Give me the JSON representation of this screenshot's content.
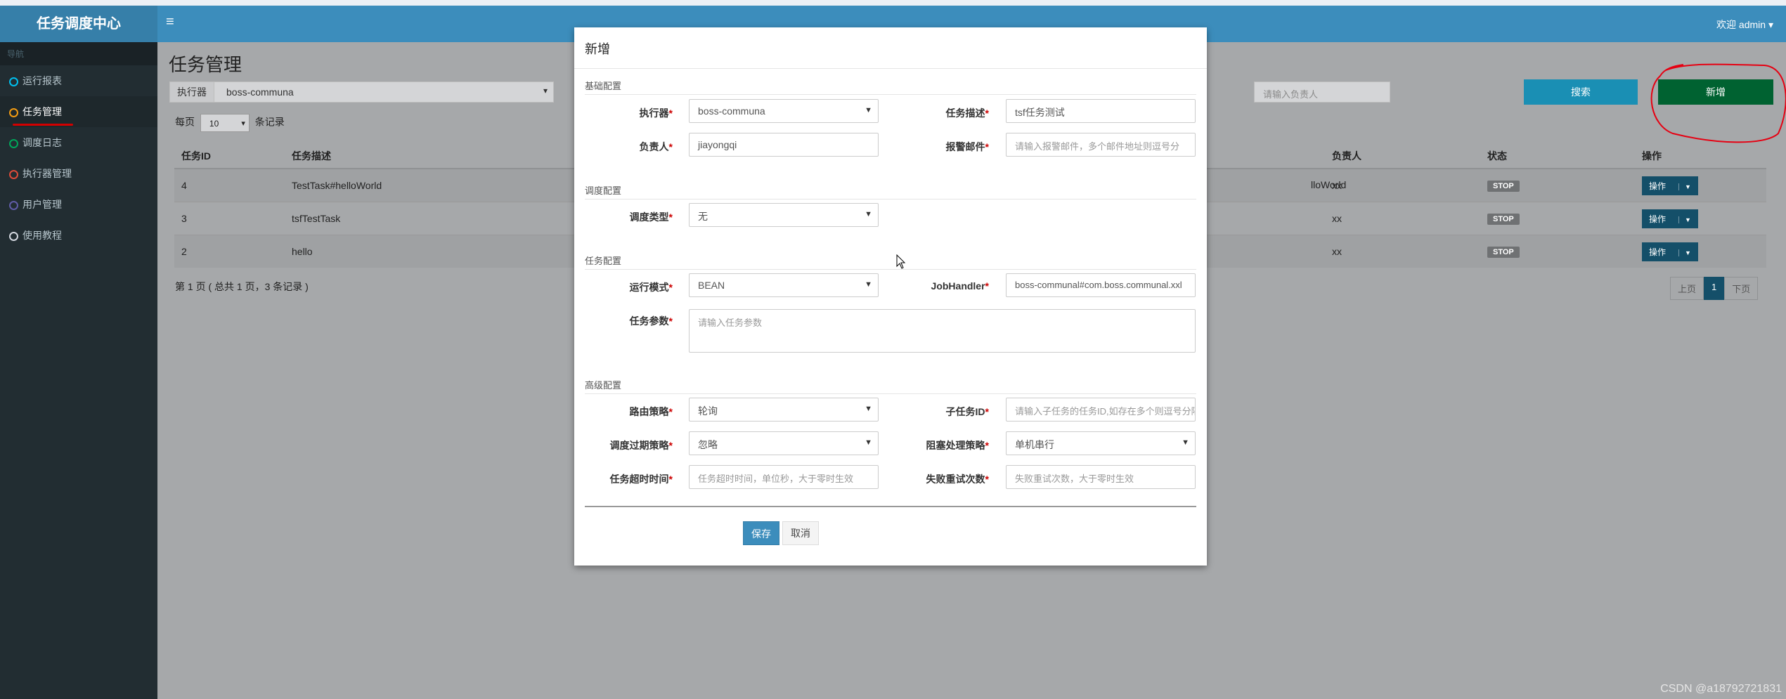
{
  "app": {
    "title": "任务调度中心",
    "user_greeting": "欢迎 admin"
  },
  "sidebar": {
    "header": "导航",
    "items": [
      {
        "label": "运行报表",
        "color": "#00c0ef"
      },
      {
        "label": "任务管理",
        "color": "#f39c12"
      },
      {
        "label": "调度日志",
        "color": "#00a65a"
      },
      {
        "label": "执行器管理",
        "color": "#dd4b39"
      },
      {
        "label": "用户管理",
        "color": "#605ca8"
      },
      {
        "label": "使用教程",
        "color": "#d2d6de"
      }
    ]
  },
  "page": {
    "title": "任务管理",
    "filter": {
      "executor_label": "执行器",
      "executor_value": "boss-communa",
      "person_placeholder": "请输入负责人",
      "search_label": "搜索",
      "add_label": "新增"
    },
    "per_page": {
      "prefix": "每页",
      "value": "10",
      "suffix": "条记录"
    },
    "table": {
      "headers": [
        "任务ID",
        "任务描述",
        "负责人",
        "状态",
        "操作"
      ],
      "rows": [
        {
          "id": "4",
          "desc": "TestTask#helloWorld",
          "handler_fragment": "lloWorld",
          "owner": "xx",
          "status": "STOP",
          "op": "操作"
        },
        {
          "id": "3",
          "desc": "tsfTestTask",
          "handler_fragment": "",
          "owner": "xx",
          "status": "STOP",
          "op": "操作"
        },
        {
          "id": "2",
          "desc": "hello",
          "handler_fragment": "",
          "owner": "xx",
          "status": "STOP",
          "op": "操作"
        }
      ]
    },
    "page_info": "第 1 页 ( 总共 1 页，3 条记录 )",
    "pager": {
      "prev": "上页",
      "current": "1",
      "next": "下页"
    }
  },
  "modal": {
    "title": "新增",
    "sections": {
      "basic": "基础配置",
      "schedule": "调度配置",
      "task": "任务配置",
      "advanced": "高级配置"
    },
    "fields": {
      "executor": {
        "label": "执行器",
        "value": "boss-communa"
      },
      "desc": {
        "label": "任务描述",
        "value": "tsf任务测试"
      },
      "owner": {
        "label": "负责人",
        "value": "jiayongqi"
      },
      "alarm": {
        "label": "报警邮件",
        "placeholder": "请输入报警邮件，多个邮件地址则逗号分"
      },
      "schedule_type": {
        "label": "调度类型",
        "value": "无"
      },
      "run_mode": {
        "label": "运行模式",
        "value": "BEAN"
      },
      "job_handler": {
        "label": "JobHandler",
        "value": "boss-communal#com.boss.communal.xxl"
      },
      "task_param": {
        "label": "任务参数",
        "placeholder": "请输入任务参数"
      },
      "route": {
        "label": "路由策略",
        "value": "轮询"
      },
      "child_id": {
        "label": "子任务ID",
        "placeholder": "请输入子任务的任务ID,如存在多个则逗号分隔"
      },
      "misfire": {
        "label": "调度过期策略",
        "value": "忽略"
      },
      "block": {
        "label": "阻塞处理策略",
        "value": "单机串行"
      },
      "timeout": {
        "label": "任务超时时间",
        "placeholder": "任务超时时间，单位秒，大于零时生效"
      },
      "retry": {
        "label": "失败重试次数",
        "placeholder": "失败重试次数，大于零时生效"
      }
    },
    "save_label": "保存",
    "cancel_label": "取消"
  },
  "watermark": "CSDN @a18792721831"
}
